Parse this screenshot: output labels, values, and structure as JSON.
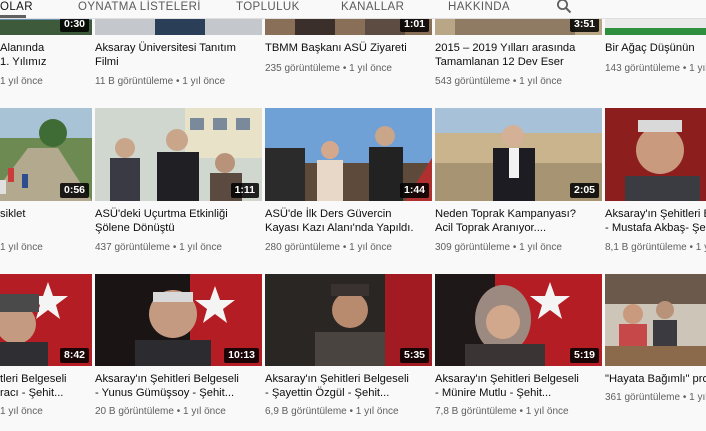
{
  "tabs": [
    {
      "label": "OLAR",
      "active": true
    },
    {
      "label": "OYNATMA LİSTELERİ"
    },
    {
      "label": "TOPLULUK"
    },
    {
      "label": "KANALLAR"
    },
    {
      "label": "HAKKINDA"
    }
  ],
  "rows": [
    {
      "cards": [
        {
          "title1": "Alanında",
          "title2": "1. Yılımız",
          "meta": "1 yıl önce",
          "duration": "0:30"
        },
        {
          "title1": "Aksaray Üniversitesi Tanıtım",
          "title2": "Filmi",
          "meta": "11 B görüntüleme • 1 yıl önce",
          "duration": ""
        },
        {
          "title1": "TBMM Başkanı ASÜ Ziyareti",
          "title2": "",
          "meta": "235 görüntüleme • 1 yıl önce",
          "duration": "1:01"
        },
        {
          "title1": "2015 – 2019 Yılları arasında",
          "title2": "Tamamlanan 12 Dev Eser",
          "meta": "543 görüntüleme • 1 yıl önce",
          "duration": "3:51"
        },
        {
          "title1": "Bir Ağaç Düşünün",
          "title2": "",
          "meta": "143 görüntüleme • 1 yıl",
          "duration": ""
        }
      ]
    },
    {
      "cards": [
        {
          "title1": "siklet",
          "title2": "",
          "meta": "1 yıl önce",
          "duration": "0:56"
        },
        {
          "title1": "ASÜ'deki Uçurtma Etkinliği",
          "title2": "Şölene Dönüştü",
          "meta": "437 görüntüleme • 1 yıl önce",
          "duration": "1:11"
        },
        {
          "title1": "ASÜ'de İlk Ders Güvercin",
          "title2": "Kayası Kazı Alanı'nda Yapıldı.",
          "meta": "280 görüntüleme • 1 yıl önce",
          "duration": "1:44"
        },
        {
          "title1": "Neden Toprak Kampanyası?",
          "title2": "Acil Toprak Aranıyor....",
          "meta": "309 görüntüleme • 1 yıl önce",
          "duration": "2:05"
        },
        {
          "title1": "Aksaray'ın Şehitleri B",
          "title2": "- Mustafa Akbaş- Şe",
          "meta": "8,1 B görüntüleme • 1 yı",
          "duration": ""
        }
      ]
    },
    {
      "cards": [
        {
          "title1": "tleri Belgeseli",
          "title2": "racı - Şehit...",
          "meta": "1 yıl önce",
          "duration": "8:42"
        },
        {
          "title1": "Aksaray'ın Şehitleri Belgeseli",
          "title2": "- Yunus Gümüşsoy - Şehit...",
          "meta": "20 B görüntüleme • 1 yıl önce",
          "duration": "10:13"
        },
        {
          "title1": "Aksaray'ın Şehitleri Belgeseli",
          "title2": "- Şayettin Özgül - Şehit...",
          "meta": "6,9 B görüntüleme • 1 yıl önce",
          "duration": "5:35"
        },
        {
          "title1": "Aksaray'ın Şehitleri Belgeseli",
          "title2": "- Münire Mutlu - Şehit...",
          "meta": "7,8 B görüntüleme • 1 yıl önce",
          "duration": "5:19"
        },
        {
          "title1": "\"Hayata Bağımlı\" pro",
          "title2": "",
          "meta": "361 görüntüleme • 1 yıl",
          "duration": ""
        }
      ]
    }
  ]
}
